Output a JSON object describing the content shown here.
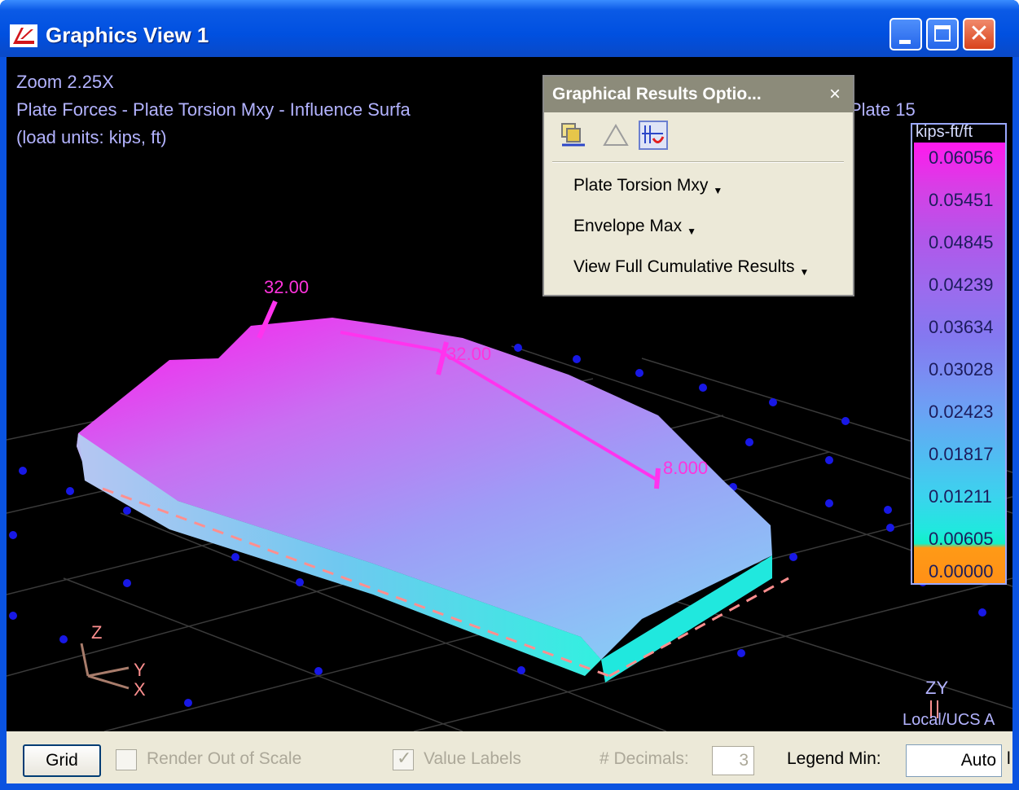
{
  "window": {
    "title": "Graphics View 1",
    "buttons": {
      "minimize": "minimize",
      "maximize": "maximize",
      "close": "close"
    }
  },
  "viewport": {
    "zoom": "Zoom 2.25X",
    "result_title": "Plate Forces - Plate Torsion Mxy - Influence Surfa",
    "result_title_suffix": "Plate 15",
    "load_units": "(load units: kips, ft)",
    "value_labels": [
      "32.00",
      "32.00",
      "8.000"
    ],
    "axes": {
      "z": "Z",
      "y": "Y",
      "x": "X"
    },
    "corner_axes": "ZY",
    "coord_system": "Local/UCS A"
  },
  "legend": {
    "title": "kips-ft/ft",
    "values": [
      "0.06056",
      "0.05451",
      "0.04845",
      "0.04239",
      "0.03634",
      "0.03028",
      "0.02423",
      "0.01817",
      "0.01211",
      "0.00605",
      "0.00000"
    ],
    "colors": {
      "max": "#ff19ee",
      "mid": "#7b8bf2",
      "min_positive": "#10f2c8",
      "zero": "#ff9016"
    }
  },
  "results_dialog": {
    "title": "Graphical Results Optio...",
    "close_label": "×",
    "result_type": "Plate Torsion Mxy",
    "envelope": "Envelope Max",
    "view_mode": "View Full Cumulative Results",
    "icons": [
      "copy-results-icon",
      "warning-triangle-icon",
      "influence-flag-icon"
    ]
  },
  "statusbar": {
    "grid_button": "Grid",
    "render_out_of_scale": "Render Out of Scale",
    "value_labels": "Value Labels",
    "value_labels_checked": true,
    "decimals_label": "# Decimals:",
    "decimals_value": "3",
    "legend_min_label": "Legend Min:",
    "legend_min_value": "Auto",
    "truncated": "l"
  }
}
